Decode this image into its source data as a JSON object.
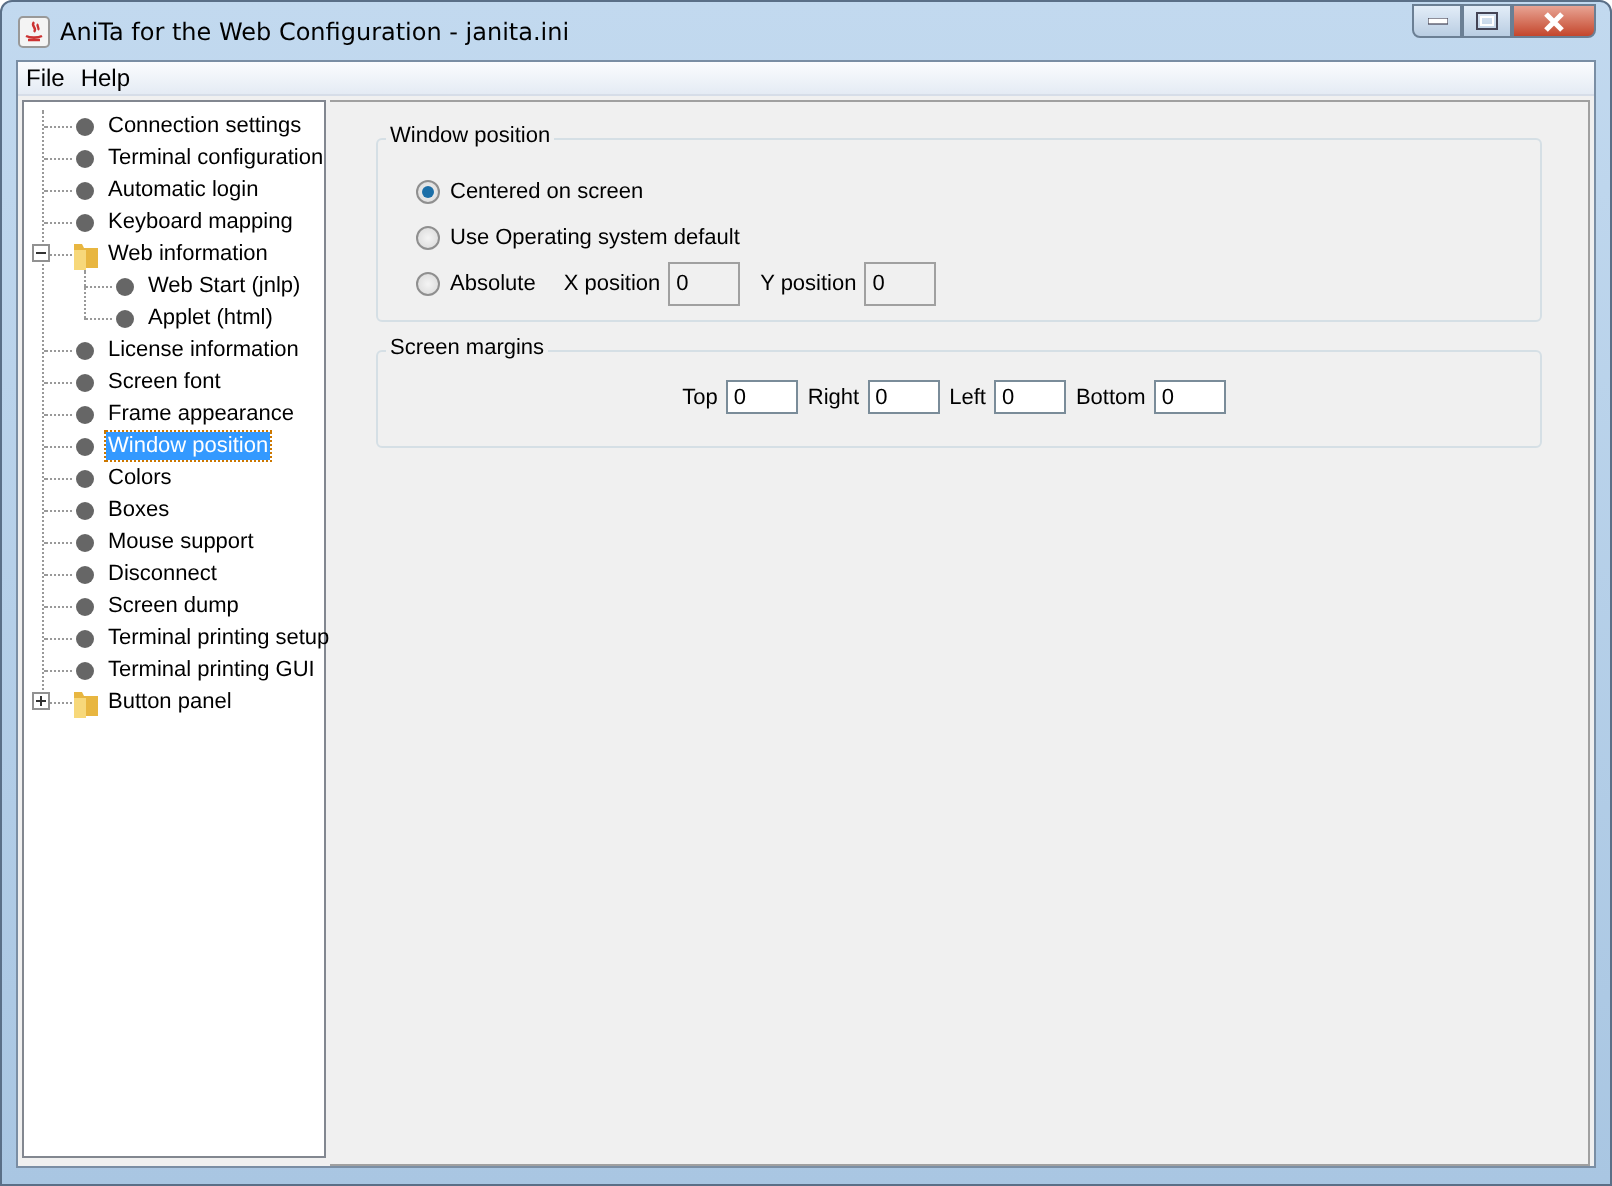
{
  "window": {
    "title": "AniTa for the Web Configuration - janita.ini"
  },
  "menu": [
    "File",
    "Help"
  ],
  "tree": [
    {
      "label": "Connection settings",
      "kind": "leaf",
      "selected": false
    },
    {
      "label": "Terminal configuration",
      "kind": "leaf",
      "selected": false
    },
    {
      "label": "Automatic login",
      "kind": "leaf",
      "selected": false
    },
    {
      "label": "Keyboard mapping",
      "kind": "leaf",
      "selected": false
    },
    {
      "label": "Web information",
      "kind": "folder",
      "selected": false,
      "expanded": true,
      "children": [
        {
          "label": "Web Start (jnlp)",
          "kind": "leaf",
          "selected": false
        },
        {
          "label": "Applet (html)",
          "kind": "leaf",
          "selected": false
        }
      ]
    },
    {
      "label": "License information",
      "kind": "leaf",
      "selected": false
    },
    {
      "label": "Screen font",
      "kind": "leaf",
      "selected": false
    },
    {
      "label": "Frame appearance",
      "kind": "leaf",
      "selected": false
    },
    {
      "label": "Window position",
      "kind": "leaf",
      "selected": true
    },
    {
      "label": "Colors",
      "kind": "leaf",
      "selected": false
    },
    {
      "label": "Boxes",
      "kind": "leaf",
      "selected": false
    },
    {
      "label": "Mouse support",
      "kind": "leaf",
      "selected": false
    },
    {
      "label": "Disconnect",
      "kind": "leaf",
      "selected": false
    },
    {
      "label": "Screen dump",
      "kind": "leaf",
      "selected": false
    },
    {
      "label": "Terminal printing setup",
      "kind": "leaf",
      "selected": false
    },
    {
      "label": "Terminal printing GUI",
      "kind": "leaf",
      "selected": false
    },
    {
      "label": "Button panel",
      "kind": "folder",
      "selected": false,
      "expanded": false
    }
  ],
  "window_position": {
    "title": "Window position",
    "options": [
      {
        "label": "Centered on screen",
        "selected": true
      },
      {
        "label": "Use Operating system default",
        "selected": false
      },
      {
        "label": "Absolute",
        "selected": false
      }
    ],
    "fields": [
      {
        "label": "X position",
        "value": "0",
        "disabled": true
      },
      {
        "label": "Y position",
        "value": "0",
        "disabled": true
      }
    ]
  },
  "screen_margins": {
    "title": "Screen margins",
    "fields": [
      {
        "label": "Top",
        "value": "0"
      },
      {
        "label": "Right",
        "value": "0"
      },
      {
        "label": "Left",
        "value": "0"
      },
      {
        "label": "Bottom",
        "value": "0"
      }
    ]
  }
}
